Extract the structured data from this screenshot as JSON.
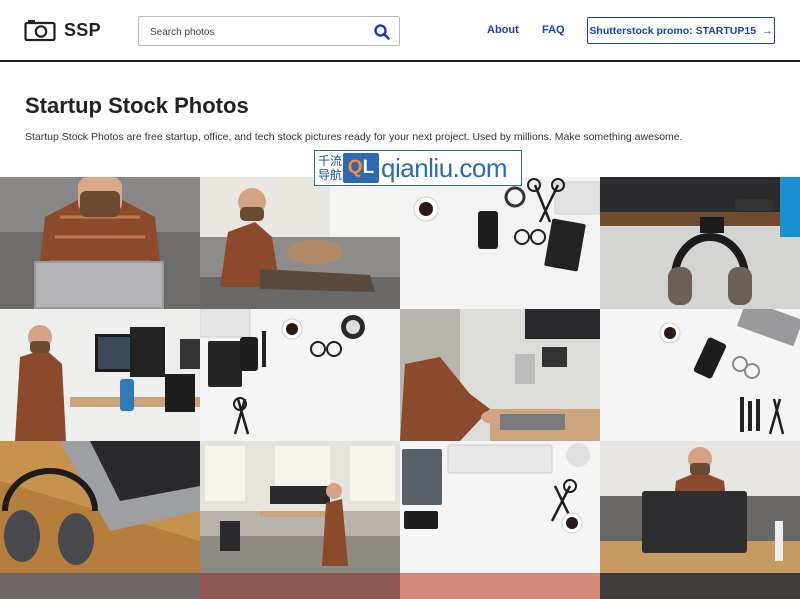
{
  "header": {
    "logo_text": "SSP",
    "search_placeholder": "Search photos",
    "nav": [
      {
        "label": "About"
      },
      {
        "label": "FAQ"
      }
    ],
    "promo_label": "Shutterstock promo: STARTUP15",
    "promo_arrow": "→"
  },
  "hero": {
    "title": "Startup Stock Photos",
    "description": "Startup Stock Photos are free startup, office, and tech stock pictures ready for your next project. Used by millions. Make something awesome."
  },
  "watermark": {
    "cn_line1": "千流",
    "cn_line2": "导航",
    "ql_q": "Q",
    "ql_l": "L",
    "url": "qianliu.com"
  },
  "photos": [
    {
      "subject": "man-plaid-shirt-laptop-couch"
    },
    {
      "subject": "man-on-couch-with-dog-phone"
    },
    {
      "subject": "desk-flatlay-coffee-phone-glasses"
    },
    {
      "subject": "headphones-on-desk-hook"
    },
    {
      "subject": "man-standing-desk-monitors"
    },
    {
      "subject": "flatlay-notebook-glasses-clock"
    },
    {
      "subject": "man-working-on-laptop-desk"
    },
    {
      "subject": "flatlay-coffee-phone-tools"
    },
    {
      "subject": "laptop-and-headphones-wood-table"
    },
    {
      "subject": "loft-office-man-standing"
    },
    {
      "subject": "flatlay-keyboard-notebook-scissors"
    },
    {
      "subject": "man-with-laptop-on-sofa"
    },
    {
      "subject": "partial-photo-gray"
    },
    {
      "subject": "partial-photo-brown"
    },
    {
      "subject": "partial-photo-salmon"
    },
    {
      "subject": "partial-photo-dark"
    }
  ]
}
